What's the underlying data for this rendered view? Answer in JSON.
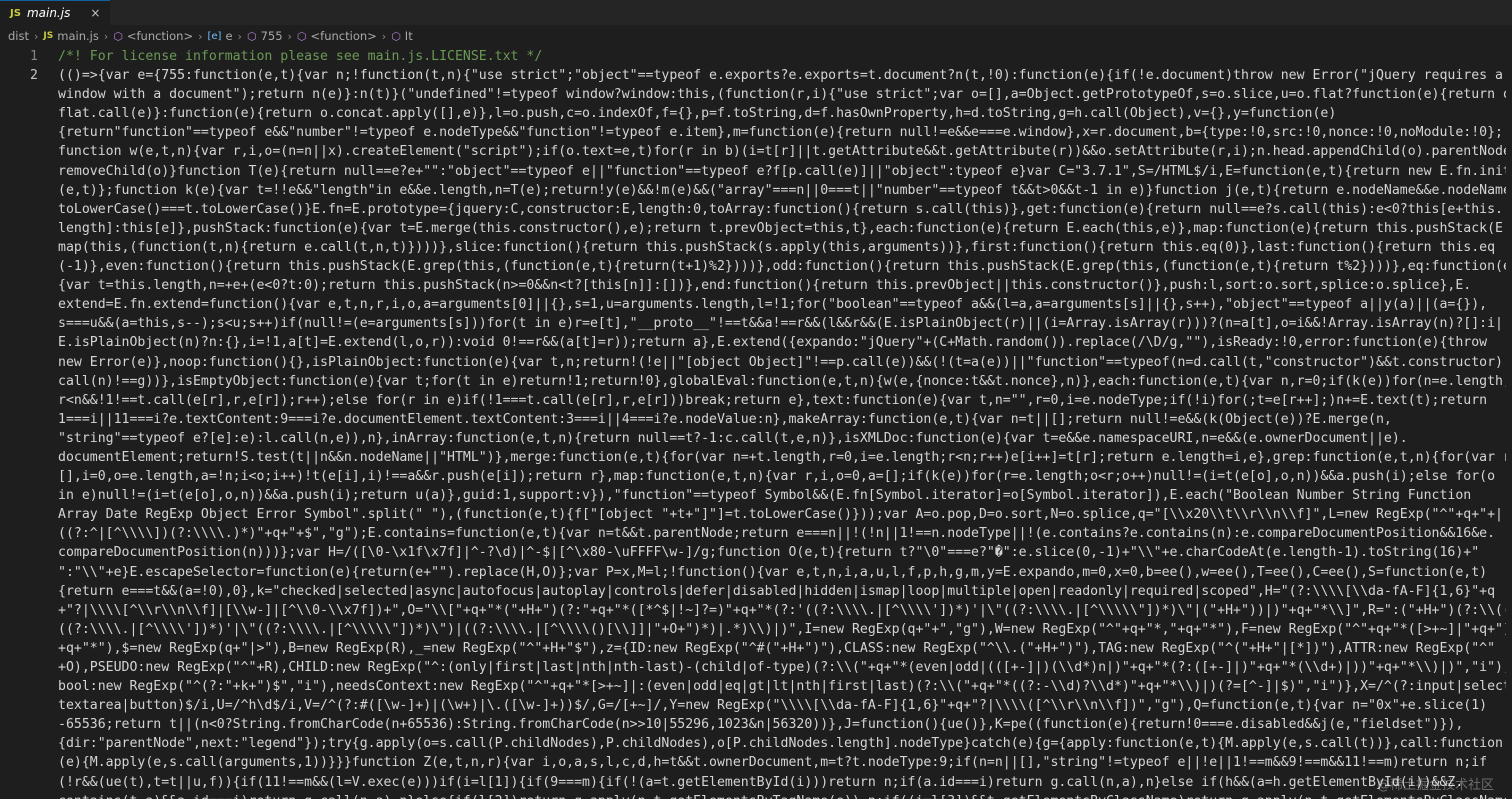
{
  "tab": {
    "icon": "JS",
    "title": "main.js",
    "close": "×"
  },
  "breadcrumbs": [
    {
      "label": "dist",
      "icon": ""
    },
    {
      "label": "main.js",
      "icon": "JS"
    },
    {
      "label": "<function>",
      "icon": "cube"
    },
    {
      "label": "e",
      "icon": "var"
    },
    {
      "label": "755",
      "icon": "cube"
    },
    {
      "label": "<function>",
      "icon": "cube"
    },
    {
      "label": "It",
      "icon": "cube"
    }
  ],
  "line_numbers": [
    "1",
    "2"
  ],
  "code_lines": [
    "/*! For license information please see main.js.LICENSE.txt */",
    "(()=>{var e={755:function(e,t){var n;!function(t,n){\"use strict\";\"object\"==typeof e.exports?e.exports=t.document?n(t,!0):function(e){if(!e.document)throw new Error(\"jQuery requires a",
    "window with a document\");return n(e)}:n(t)}(\"undefined\"!=typeof window?window:this,(function(r,i){\"use strict\";var o=[],a=Object.getPrototypeOf,s=o.slice,u=o.flat?function(e){return o.",
    "flat.call(e)}:function(e){return o.concat.apply([],e)},l=o.push,c=o.indexOf,f={},p=f.toString,d=f.hasOwnProperty,h=d.toString,g=h.call(Object),v={},y=function(e)",
    "{return\"function\"==typeof e&&\"number\"!=typeof e.nodeType&&\"function\"!=typeof e.item},m=function(e){return null!=e&&e===e.window},x=r.document,b={type:!0,src:!0,nonce:!0,noModule:!0};",
    "function w(e,t,n){var r,i,o=(n=n||x).createElement(\"script\");if(o.text=e,t)for(r in b)(i=t[r]||t.getAttribute&&t.getAttribute(r))&&o.setAttribute(r,i);n.head.appendChild(o).parentNode.",
    "removeChild(o)}function T(e){return null==e?e+\"\":\"object\"==typeof e||\"function\"==typeof e?f[p.call(e)]||\"object\":typeof e}var C=\"3.7.1\",S=/HTML$/i,E=function(e,t){return new E.fn.init",
    "(e,t)};function k(e){var t=!!e&&\"length\"in e&&e.length,n=T(e);return!y(e)&&!m(e)&&(\"array\"===n||0===t||\"number\"==typeof t&&t>0&&t-1 in e)}function j(e,t){return e.nodeName&&e.nodeName.",
    "toLowerCase()===t.toLowerCase()}E.fn=E.prototype={jquery:C,constructor:E,length:0,toArray:function(){return s.call(this)},get:function(e){return null==e?s.call(this):e<0?this[e+this.",
    "length]:this[e]},pushStack:function(e){var t=E.merge(this.constructor(),e);return t.prevObject=this,t},each:function(e){return E.each(this,e)},map:function(e){return this.pushStack(E.",
    "map(this,(function(t,n){return e.call(t,n,t)})))},slice:function(){return this.pushStack(s.apply(this,arguments))},first:function(){return this.eq(0)},last:function(){return this.eq",
    "(-1)},even:function(){return this.pushStack(E.grep(this,(function(e,t){return(t+1)%2})))},odd:function(){return this.pushStack(E.grep(this,(function(e,t){return t%2})))},eq:function(e)",
    "{var t=this.length,n=+e+(e<0?t:0);return this.pushStack(n>=0&&n<t?[this[n]]:[])},end:function(){return this.prevObject||this.constructor()},push:l,sort:o.sort,splice:o.splice},E.",
    "extend=E.fn.extend=function(){var e,t,n,r,i,o,a=arguments[0]||{},s=1,u=arguments.length,l=!1;for(\"boolean\"==typeof a&&(l=a,a=arguments[s]||{},s++),\"object\"==typeof a||y(a)||(a={}),",
    "s===u&&(a=this,s--);s<u;s++)if(null!=(e=arguments[s]))for(t in e)r=e[t],\"__proto__\"!==t&&a!==r&&(l&&r&&(E.isPlainObject(r)||(i=Array.isArray(r)))?(n=a[t],o=i&&!Array.isArray(n)?[]:i||",
    "E.isPlainObject(n)?n:{},i=!1,a[t]=E.extend(l,o,r)):void 0!==r&&(a[t]=r));return a},E.extend({expando:\"jQuery\"+(C+Math.random()).replace(/\\D/g,\"\"),isReady:!0,error:function(e){throw",
    "new Error(e)},noop:function(){},isPlainObject:function(e){var t,n;return!(!e||\"[object Object]\"!==p.call(e))&&(!(t=a(e))||\"function\"==typeof(n=d.call(t,\"constructor\")&&t.constructor)||h.",
    "call(n)!==g))},isEmptyObject:function(e){var t;for(t in e)return!1;return!0},globalEval:function(e,t,n){w(e,{nonce:t&&t.nonce},n)},each:function(e,t){var n,r=0;if(k(e))for(n=e.length;",
    "r<n&&!1!==t.call(e[r],r,e[r]);r++);else for(r in e)if(!1===t.call(e[r],r,e[r]))break;return e},text:function(e){var t,n=\"\",r=0,i=e.nodeType;if(!i)for(;t=e[r++];)n+=E.text(t);return",
    "1===i||11===i?e.textContent:9===i?e.documentElement.textContent:3===i||4===i?e.nodeValue:n},makeArray:function(e,t){var n=t||[];return null!=e&&(k(Object(e))?E.merge(n,",
    "\"string\"==typeof e?[e]:e):l.call(n,e)),n},inArray:function(e,t,n){return null==t?-1:c.call(t,e,n)},isXMLDoc:function(e){var t=e&&e.namespaceURI,n=e&&(e.ownerDocument||e).",
    "documentElement;return!S.test(t||n&&n.nodeName||\"HTML\")},merge:function(e,t){for(var n=+t.length,r=0,i=e.length;r<n;r++)e[i++]=t[r];return e.length=i,e},grep:function(e,t,n){for(var r=",
    "[],i=0,o=e.length,a=!n;i<o;i++)!t(e[i],i)!==a&&r.push(e[i]);return r},map:function(e,t,n){var r,i,o=0,a=[];if(k(e))for(r=e.length;o<r;o++)null!=(i=t(e[o],o,n))&&a.push(i);else for(o",
    "in e)null!=(i=t(e[o],o,n))&&a.push(i);return u(a)},guid:1,support:v}),\"function\"==typeof Symbol&&(E.fn[Symbol.iterator]=o[Symbol.iterator]),E.each(\"Boolean Number String Function",
    "Array Date RegExp Object Error Symbol\".split(\" \"),(function(e,t){f[\"[object \"+t+\"]\"]=t.toLowerCase()}));var A=o.pop,D=o.sort,N=o.splice,q=\"[\\\\x20\\\\t\\\\r\\\\n\\\\f]\",L=new RegExp(\"^\"+q+\"+|",
    "((?:^|[^\\\\\\\\])(?:\\\\\\\\.)*)\"+q+\"+$\",\"g\");E.contains=function(e,t){var n=t&&t.parentNode;return e===n||!(!n||1!==n.nodeType||!(e.contains?e.contains(n):e.compareDocumentPosition&&16&e.",
    "compareDocumentPosition(n)))};var H=/([\\0-\\x1f\\x7f]|^-?\\d)|^-$|[^\\x80-\\uFFFF\\w-]/g;function O(e,t){return t?\"\\0\"===e?\"�\":e.slice(0,-1)+\"\\\\\"+e.charCodeAt(e.length-1).toString(16)+\"",
    "\":\"\\\\\"+e}E.escapeSelector=function(e){return(e+\"\").replace(H,O)};var P=x,M=l;!function(){var e,t,n,i,a,u,l,f,p,h,g,m,y=E.expando,m=0,x=0,b=ee(),w=ee(),T=ee(),C=ee(),S=function(e,t)",
    "{return e===t&&(a=!0),0},k=\"checked|selected|async|autofocus|autoplay|controls|defer|disabled|hidden|ismap|loop|multiple|open|readonly|required|scoped\",H=\"(?:\\\\\\\\[\\\\da-fA-F]{1,6}\"+q",
    "+\"?|\\\\\\\\[^\\\\r\\\\n\\\\f]|[\\\\w-]|[^\\\\0-\\\\x7f])+\",O=\"\\\\[\"+q+\"*(\"+H+\")(?:\"+q+\"*([*^$|!~]?=)\"+q+\"*(?:'((?:\\\\\\\\.|[^\\\\\\\\'])*)'|\\\"((?:\\\\\\\\.|[^\\\\\\\\\\\"])*)\\\"|(\"+H+\"))|)\"+q+\"*\\\\]\",R=\":(\"+H+\")(?:\\\\((('",
    "((?:\\\\\\\\.|[^\\\\\\\\'])*)'|\\\"((?:\\\\\\\\.|[^\\\\\\\\\\\"])*)\\\")|((?:\\\\\\\\.|[^\\\\\\\\()[\\\\]]|\"+O+\")*)|.*)\\\\)|)\",I=new RegExp(q+\"+\",\"g\"),W=new RegExp(\"^\"+q+\"*,\"+q+\"*\"),F=new RegExp(\"^\"+q+\"*([>+~]|\"+q+\")\"",
    "+q+\"*\"),$=new RegExp(q+\"|>\"),B=new RegExp(R),_=new RegExp(\"^\"+H+\"$\"),z={ID:new RegExp(\"^#(\"+H+\")\"),CLASS:new RegExp(\"^\\\\.(\"+H+\")\"),TAG:new RegExp(\"^(\"+H+\"|[*])\"),ATTR:new RegExp(\"^\"",
    "+O),PSEUDO:new RegExp(\"^\"+R),CHILD:new RegExp(\"^:(only|first|last|nth|nth-last)-(child|of-type)(?:\\\\(\"+q+\"*(even|odd|(([+-]|)(\\\\d*)n|)\"+q+\"*(?:([+-]|)\"+q+\"*(\\\\d+)|))\"+q+\"*\\\\)|)\",\"i\"),",
    "bool:new RegExp(\"^(?:\"+k+\")$\",\"i\"),needsContext:new RegExp(\"^\"+q+\"*[>+~]|:(even|odd|eq|gt|lt|nth|first|last)(?:\\\\(\"+q+\"*((?:-\\\\d)?\\\\d*)\"+q+\"*\\\\)|)(?=[^-]|$)\",\"i\")},X=/^(?:input|select|",
    "textarea|button)$/i,U=/^h\\d$/i,V=/^(?:#([\\w-]+)|(\\w+)|\\.([\\w-]+))$/,G=/[+~]/,Y=new RegExp(\"\\\\\\\\[\\\\da-fA-F]{1,6}\"+q+\"?|\\\\\\\\([^\\\\r\\\\n\\\\f])\",\"g\"),Q=function(e,t){var n=\"0x\"+e.slice(1)",
    "-65536;return t||(n<0?String.fromCharCode(n+65536):String.fromCharCode(n>>10|55296,1023&n|56320))},J=function(){ue()},K=pe((function(e){return!0===e.disabled&&j(e,\"fieldset\")}),",
    "{dir:\"parentNode\",next:\"legend\"});try{g.apply(o=s.call(P.childNodes),P.childNodes),o[P.childNodes.length].nodeType}catch(e){g={apply:function(e,t){M.apply(e,s.call(t))},call:function",
    "(e){M.apply(e,s.call(arguments,1))}}}function Z(e,t,n,r){var i,o,a,s,l,c,d,h=t&&t.ownerDocument,m=t?t.nodeType:9;if(n=n||[],\"string\"!=typeof e||!e||1!==m&&9!==m&&11!==m)return n;if",
    "(!r&&(ue(t),t=t||u,f)){if(11!==m&&(l=V.exec(e)))if(i=l[1]){if(9===m){if(!(a=t.getElementById(i)))return n;if(a.id===i)return g.call(n,a),n}else if(h&&(a=h.getElementById(i))&&Z.",
    "contains(t,a)&&a.id===i)return g.call(n,a),n}else{if(l[2])return g.apply(n,t.getElementsByTagName(e)),n;if((i=l[3])&&t.getElementsByClassName)return g.apply(n,t.getElementsByClassName"
  ],
  "watermark": "@稀土掘金技术社区"
}
